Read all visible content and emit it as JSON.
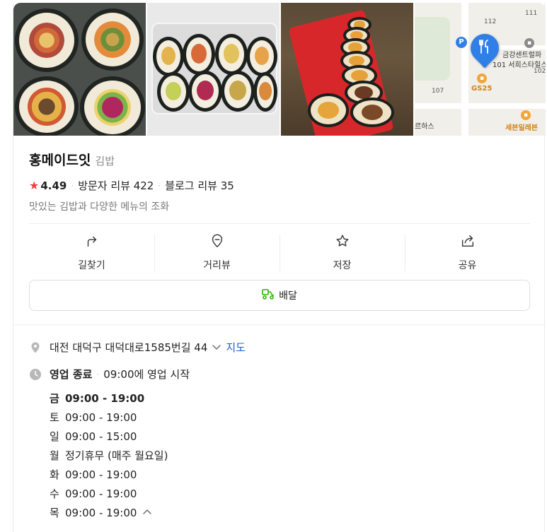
{
  "map": {
    "labels": {
      "n111": "111",
      "n112": "112",
      "n107": "107",
      "building": "금강센트럴파",
      "building2": "101 서희스타힐스",
      "n102": "102",
      "gs25": "GS25",
      "seven": "세븐일레븐",
      "hawks": "르하스"
    },
    "pin_icon": "fork-knife-icon"
  },
  "place": {
    "name": "홍메이드잇",
    "category": "김밥",
    "rating": "4.49",
    "visitor_reviews": "방문자 리뷰 422",
    "blog_reviews": "블로그 리뷰 35",
    "description": "맛있는 김밥과 다양한 메뉴의 조화"
  },
  "actions": [
    {
      "label": "길찾기",
      "icon": "directions-icon"
    },
    {
      "label": "거리뷰",
      "icon": "street-view-icon"
    },
    {
      "label": "저장",
      "icon": "star-icon"
    },
    {
      "label": "공유",
      "icon": "share-icon"
    }
  ],
  "delivery": {
    "label": "배달",
    "icon": "delivery-scooter-icon"
  },
  "address": {
    "text": "대전 대덕구 대덕대로1585번길 44",
    "map_link": "지도"
  },
  "status": {
    "state": "영업 종료",
    "next": "09:00에 영업 시작"
  },
  "hours": [
    {
      "day": "금",
      "time": "09:00 - 19:00",
      "today": true
    },
    {
      "day": "토",
      "time": "09:00 - 19:00"
    },
    {
      "day": "일",
      "time": "09:00 - 15:00"
    },
    {
      "day": "월",
      "time": "정기휴무 (매주 월요일)"
    },
    {
      "day": "화",
      "time": "09:00 - 19:00"
    },
    {
      "day": "수",
      "time": "09:00 - 19:00"
    },
    {
      "day": "목",
      "time": "09:00 - 19:00"
    }
  ],
  "colors": {
    "star": "#f03f3f",
    "link": "#1a5dd1",
    "pin": "#2f7fe7",
    "delivery": "#2db400"
  }
}
